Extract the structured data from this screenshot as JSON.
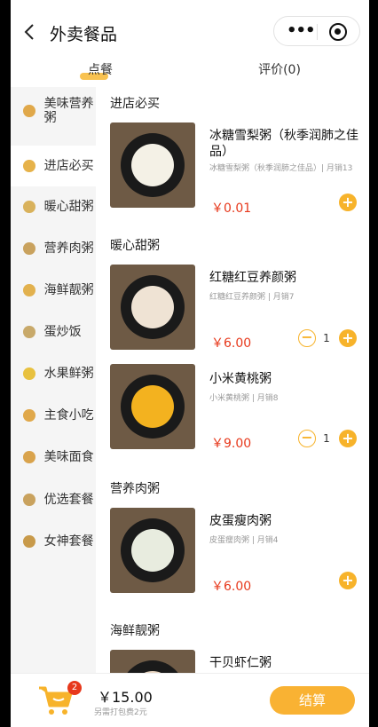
{
  "header": {
    "back_label": "<",
    "title": "外卖餐品"
  },
  "tabs": [
    {
      "label": "点餐"
    },
    {
      "label": "评价(0)"
    }
  ],
  "sidebar": {
    "items": [
      {
        "label": "美味营养粥",
        "icon": "dumpling-icon",
        "color": "#e0a84a"
      },
      {
        "label": "进店必买",
        "icon": "bowl-icon",
        "color": "#e6b24a"
      },
      {
        "label": "暖心甜粥",
        "icon": "egg-icon",
        "color": "#d9b25c"
      },
      {
        "label": "营养肉粥",
        "icon": "pot-icon",
        "color": "#c9a25e"
      },
      {
        "label": "海鲜靓粥",
        "icon": "shrimp-icon",
        "color": "#e2b14e"
      },
      {
        "label": "蛋炒饭",
        "icon": "rice-icon",
        "color": "#c8a96a"
      },
      {
        "label": "水果鲜粥",
        "icon": "banana-icon",
        "color": "#e8c13f"
      },
      {
        "label": "主食小吃",
        "icon": "snack-icon",
        "color": "#e0a84a"
      },
      {
        "label": "美味面食",
        "icon": "noodle-icon",
        "color": "#d9a34c"
      },
      {
        "label": "优选套餐",
        "icon": "set-meal-icon",
        "color": "#c9a25e"
      },
      {
        "label": "女神套餐",
        "icon": "drink-icon",
        "color": "#c89a4a"
      }
    ]
  },
  "sections": [
    {
      "title": "进店必买"
    },
    {
      "title": "暖心甜粥"
    },
    {
      "title": "营养肉粥"
    },
    {
      "title": "海鲜靓粥"
    }
  ],
  "items": [
    {
      "name": "冰糖雪梨粥（秋季润肺之佳品）",
      "desc": "冰糖雪梨粥（秋季润肺之佳品）| 月销13",
      "price": "￥0.01",
      "qty": "",
      "color": "#f4f1e6"
    },
    {
      "name": "红糖红豆养颜粥",
      "desc": "红糖红豆养颜粥 | 月销7",
      "price": "￥6.00",
      "qty": "1",
      "color": "#efe3d4"
    },
    {
      "name": "小米黄桃粥",
      "desc": "小米黄桃粥 | 月销8",
      "price": "￥9.00",
      "qty": "1",
      "color": "#f3b21f"
    },
    {
      "name": "皮蛋瘦肉粥",
      "desc": "皮蛋瘦肉粥 | 月销4",
      "price": "￥6.00",
      "qty": "",
      "color": "#e8ecdf"
    },
    {
      "name": "干贝虾仁粥",
      "desc": "",
      "price": "",
      "qty": "",
      "color": "#e8d6c2"
    }
  ],
  "footer": {
    "cart_count": "2",
    "total": "￥15.00",
    "packaging_note": "另需打包费2元",
    "checkout_label": "结算"
  },
  "colors": {
    "accent": "#f7b32b",
    "price": "#e7381b"
  }
}
